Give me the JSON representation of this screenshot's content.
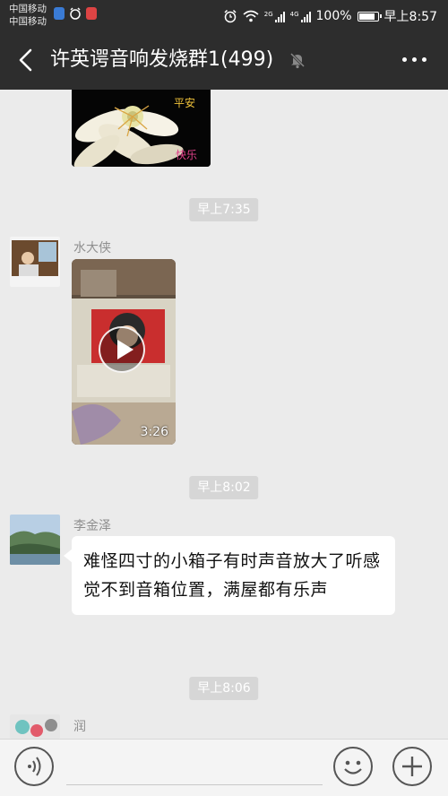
{
  "statusbar": {
    "carrier1": "中国移动",
    "carrier2": "中国移动",
    "net1": "2G",
    "net2": "4G",
    "battery": "100%",
    "time": "早上8:57"
  },
  "header": {
    "title": "许英谔音响发烧群1(499)",
    "icons": [
      "back-arrow-icon",
      "mute-bell-icon",
      "more-icon"
    ]
  },
  "messages": {
    "image_caption_top": "平安",
    "image_caption_bottom": "快乐",
    "time1": "早上7:35",
    "sender1": "水大侠",
    "video_duration": "3:26",
    "time2": "早上8:02",
    "sender2": "李金泽",
    "text2": "难怪四寸的小箱子有时声音放大了听感觉不到音箱位置，满屋都有乐声",
    "time3": "早上8:06",
    "sender3": "润"
  },
  "colors": {
    "bar": "#2d2d2d",
    "chat_bg": "#ebebeb",
    "time_pill": "#d6d6d6",
    "bubble": "#ffffff"
  }
}
